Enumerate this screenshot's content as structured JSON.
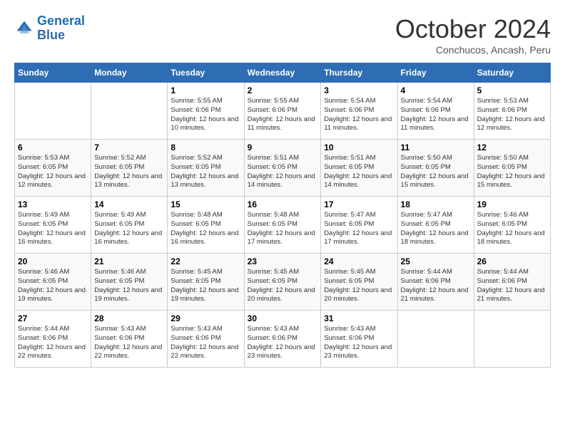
{
  "logo": {
    "line1": "General",
    "line2": "Blue"
  },
  "title": "October 2024",
  "location": "Conchucos, Ancash, Peru",
  "days_header": [
    "Sunday",
    "Monday",
    "Tuesday",
    "Wednesday",
    "Thursday",
    "Friday",
    "Saturday"
  ],
  "weeks": [
    [
      {
        "day": "",
        "info": ""
      },
      {
        "day": "",
        "info": ""
      },
      {
        "day": "1",
        "sunrise": "Sunrise: 5:55 AM",
        "sunset": "Sunset: 6:06 PM",
        "daylight": "Daylight: 12 hours and 10 minutes."
      },
      {
        "day": "2",
        "sunrise": "Sunrise: 5:55 AM",
        "sunset": "Sunset: 6:06 PM",
        "daylight": "Daylight: 12 hours and 11 minutes."
      },
      {
        "day": "3",
        "sunrise": "Sunrise: 5:54 AM",
        "sunset": "Sunset: 6:06 PM",
        "daylight": "Daylight: 12 hours and 11 minutes."
      },
      {
        "day": "4",
        "sunrise": "Sunrise: 5:54 AM",
        "sunset": "Sunset: 6:06 PM",
        "daylight": "Daylight: 12 hours and 11 minutes."
      },
      {
        "day": "5",
        "sunrise": "Sunrise: 5:53 AM",
        "sunset": "Sunset: 6:06 PM",
        "daylight": "Daylight: 12 hours and 12 minutes."
      }
    ],
    [
      {
        "day": "6",
        "sunrise": "Sunrise: 5:53 AM",
        "sunset": "Sunset: 6:05 PM",
        "daylight": "Daylight: 12 hours and 12 minutes."
      },
      {
        "day": "7",
        "sunrise": "Sunrise: 5:52 AM",
        "sunset": "Sunset: 6:05 PM",
        "daylight": "Daylight: 12 hours and 13 minutes."
      },
      {
        "day": "8",
        "sunrise": "Sunrise: 5:52 AM",
        "sunset": "Sunset: 6:05 PM",
        "daylight": "Daylight: 12 hours and 13 minutes."
      },
      {
        "day": "9",
        "sunrise": "Sunrise: 5:51 AM",
        "sunset": "Sunset: 6:05 PM",
        "daylight": "Daylight: 12 hours and 14 minutes."
      },
      {
        "day": "10",
        "sunrise": "Sunrise: 5:51 AM",
        "sunset": "Sunset: 6:05 PM",
        "daylight": "Daylight: 12 hours and 14 minutes."
      },
      {
        "day": "11",
        "sunrise": "Sunrise: 5:50 AM",
        "sunset": "Sunset: 6:05 PM",
        "daylight": "Daylight: 12 hours and 15 minutes."
      },
      {
        "day": "12",
        "sunrise": "Sunrise: 5:50 AM",
        "sunset": "Sunset: 6:05 PM",
        "daylight": "Daylight: 12 hours and 15 minutes."
      }
    ],
    [
      {
        "day": "13",
        "sunrise": "Sunrise: 5:49 AM",
        "sunset": "Sunset: 6:05 PM",
        "daylight": "Daylight: 12 hours and 16 minutes."
      },
      {
        "day": "14",
        "sunrise": "Sunrise: 5:49 AM",
        "sunset": "Sunset: 6:05 PM",
        "daylight": "Daylight: 12 hours and 16 minutes."
      },
      {
        "day": "15",
        "sunrise": "Sunrise: 5:48 AM",
        "sunset": "Sunset: 6:05 PM",
        "daylight": "Daylight: 12 hours and 16 minutes."
      },
      {
        "day": "16",
        "sunrise": "Sunrise: 5:48 AM",
        "sunset": "Sunset: 6:05 PM",
        "daylight": "Daylight: 12 hours and 17 minutes."
      },
      {
        "day": "17",
        "sunrise": "Sunrise: 5:47 AM",
        "sunset": "Sunset: 6:05 PM",
        "daylight": "Daylight: 12 hours and 17 minutes."
      },
      {
        "day": "18",
        "sunrise": "Sunrise: 5:47 AM",
        "sunset": "Sunset: 6:05 PM",
        "daylight": "Daylight: 12 hours and 18 minutes."
      },
      {
        "day": "19",
        "sunrise": "Sunrise: 5:46 AM",
        "sunset": "Sunset: 6:05 PM",
        "daylight": "Daylight: 12 hours and 18 minutes."
      }
    ],
    [
      {
        "day": "20",
        "sunrise": "Sunrise: 5:46 AM",
        "sunset": "Sunset: 6:05 PM",
        "daylight": "Daylight: 12 hours and 19 minutes."
      },
      {
        "day": "21",
        "sunrise": "Sunrise: 5:46 AM",
        "sunset": "Sunset: 6:05 PM",
        "daylight": "Daylight: 12 hours and 19 minutes."
      },
      {
        "day": "22",
        "sunrise": "Sunrise: 5:45 AM",
        "sunset": "Sunset: 6:05 PM",
        "daylight": "Daylight: 12 hours and 19 minutes."
      },
      {
        "day": "23",
        "sunrise": "Sunrise: 5:45 AM",
        "sunset": "Sunset: 6:05 PM",
        "daylight": "Daylight: 12 hours and 20 minutes."
      },
      {
        "day": "24",
        "sunrise": "Sunrise: 5:45 AM",
        "sunset": "Sunset: 6:05 PM",
        "daylight": "Daylight: 12 hours and 20 minutes."
      },
      {
        "day": "25",
        "sunrise": "Sunrise: 5:44 AM",
        "sunset": "Sunset: 6:06 PM",
        "daylight": "Daylight: 12 hours and 21 minutes."
      },
      {
        "day": "26",
        "sunrise": "Sunrise: 5:44 AM",
        "sunset": "Sunset: 6:06 PM",
        "daylight": "Daylight: 12 hours and 21 minutes."
      }
    ],
    [
      {
        "day": "27",
        "sunrise": "Sunrise: 5:44 AM",
        "sunset": "Sunset: 6:06 PM",
        "daylight": "Daylight: 12 hours and 22 minutes."
      },
      {
        "day": "28",
        "sunrise": "Sunrise: 5:43 AM",
        "sunset": "Sunset: 6:06 PM",
        "daylight": "Daylight: 12 hours and 22 minutes."
      },
      {
        "day": "29",
        "sunrise": "Sunrise: 5:43 AM",
        "sunset": "Sunset: 6:06 PM",
        "daylight": "Daylight: 12 hours and 22 minutes."
      },
      {
        "day": "30",
        "sunrise": "Sunrise: 5:43 AM",
        "sunset": "Sunset: 6:06 PM",
        "daylight": "Daylight: 12 hours and 23 minutes."
      },
      {
        "day": "31",
        "sunrise": "Sunrise: 5:43 AM",
        "sunset": "Sunset: 6:06 PM",
        "daylight": "Daylight: 12 hours and 23 minutes."
      },
      {
        "day": "",
        "info": ""
      },
      {
        "day": "",
        "info": ""
      }
    ]
  ]
}
